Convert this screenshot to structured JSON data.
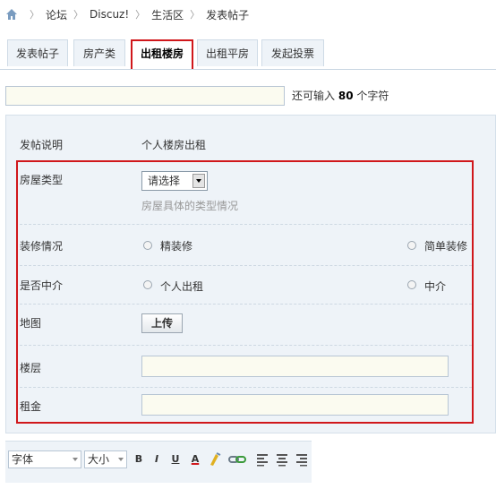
{
  "breadcrumb": [
    "论坛",
    "Discuz!",
    "生活区",
    "发表帖子"
  ],
  "tabs": [
    {
      "label": "发表帖子",
      "active": false
    },
    {
      "label": "房产类",
      "active": false
    },
    {
      "label": "出租楼房",
      "active": true
    },
    {
      "label": "出租平房",
      "active": false
    },
    {
      "label": "发起投票",
      "active": false
    }
  ],
  "subject": {
    "value": "",
    "remaining_prefix": "还可输入",
    "remaining_count": "80",
    "remaining_suffix": "个字符"
  },
  "form": {
    "description": {
      "label": "发帖说明",
      "value": "个人楼房出租"
    },
    "house_type": {
      "label": "房屋类型",
      "select_value": "请选择",
      "hint": "房屋具体的类型情况"
    },
    "decoration": {
      "label": "装修情况",
      "options": [
        "精装修",
        "简单装修"
      ]
    },
    "agency": {
      "label": "是否中介",
      "options": [
        "个人出租",
        "中介"
      ]
    },
    "map": {
      "label": "地图",
      "button": "上传"
    },
    "floor": {
      "label": "楼层",
      "value": ""
    },
    "rent": {
      "label": "租金",
      "value": ""
    }
  },
  "toolbar": {
    "font_select": "字体",
    "size_select": "大小",
    "buttons": [
      "B",
      "I",
      "U",
      "A"
    ]
  },
  "colors": {
    "accent_red": "#d0171b",
    "panel_bg": "#eef3f8",
    "input_bg": "#fbfbf0"
  }
}
